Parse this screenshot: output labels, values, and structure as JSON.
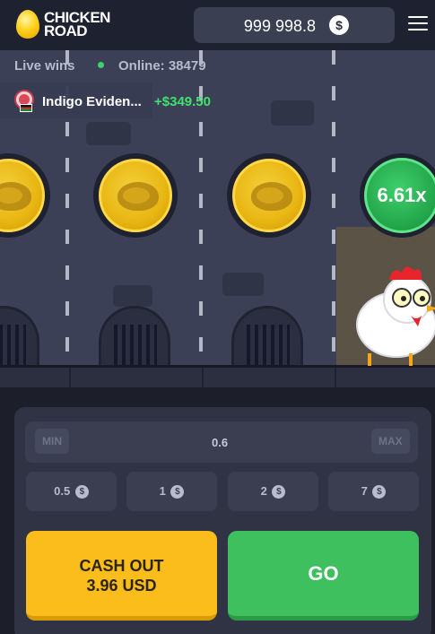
{
  "header": {
    "logo_line1": "CHICKEN",
    "logo_line2": "ROAD",
    "balance": "999 998.8",
    "currency_symbol": "$"
  },
  "live": {
    "label": "Live wins",
    "online_label": "Online: 38479",
    "latest_win": {
      "name": "Indigo Eviden...",
      "amount": "+$349.50"
    }
  },
  "game": {
    "current_multiplier": "6.61x",
    "colors": {
      "coin": "#e8b612",
      "multiplier": "#22a34a"
    }
  },
  "bet": {
    "min_label": "MIN",
    "max_label": "MAX",
    "value": "0.6",
    "quick_bets": [
      "0.5",
      "1",
      "2",
      "7"
    ],
    "currency_symbol": "$"
  },
  "actions": {
    "cashout_label": "CASH OUT",
    "cashout_amount": "3.96 USD",
    "go_label": "GO",
    "colors": {
      "cashout": "#fbbd1b",
      "go": "#3ec05e"
    }
  }
}
